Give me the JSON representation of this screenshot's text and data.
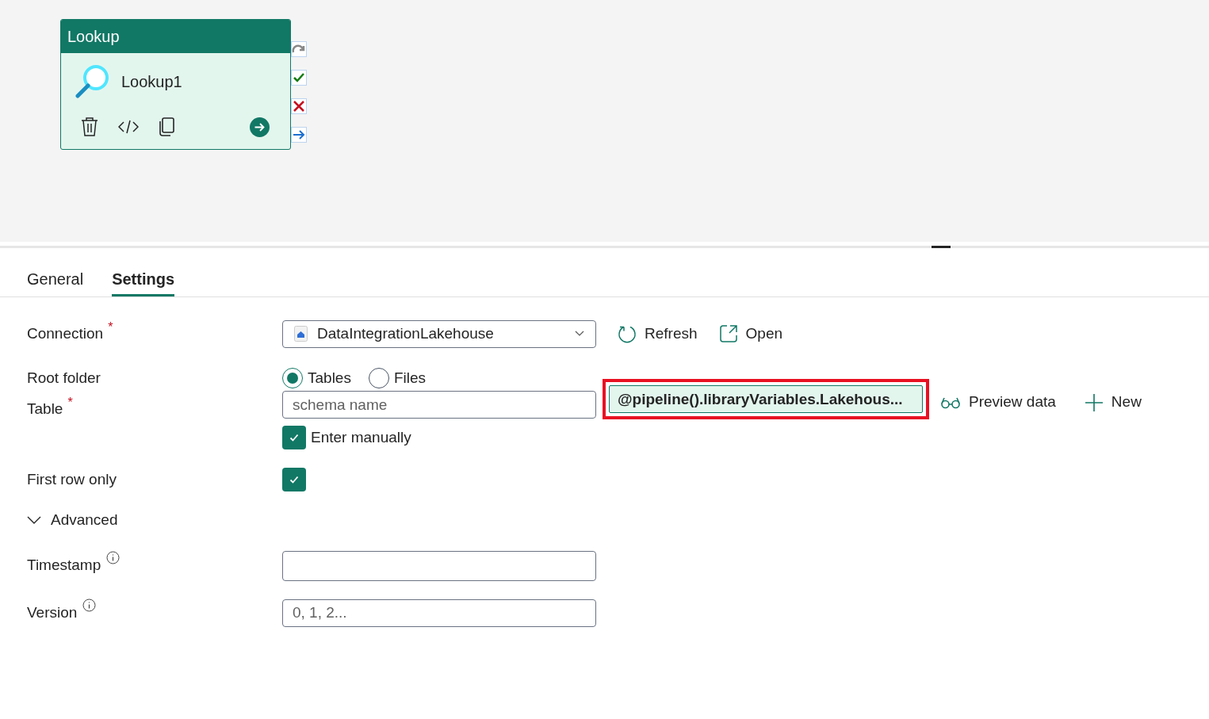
{
  "activity": {
    "type": "Lookup",
    "name": "Lookup1"
  },
  "tabs": [
    {
      "label": "General",
      "selected": false
    },
    {
      "label": "Settings",
      "selected": true
    }
  ],
  "connection": {
    "label": "Connection",
    "required_mark": "*",
    "value": "DataIntegrationLakehouse",
    "actions": [
      "Refresh",
      "Open"
    ]
  },
  "root_folder": {
    "label": "Root folder",
    "options": [
      {
        "label": "Tables",
        "selected": true
      },
      {
        "label": "Files",
        "selected": false
      }
    ]
  },
  "table": {
    "label": "Table",
    "required_mark": "*",
    "schema_placeholder": "schema name",
    "value": "@pipeline().libraryVariables.Lakehous...",
    "highlighted": true,
    "enter_manually": {
      "label": "Enter manually",
      "checked": true
    },
    "actions": [
      "Preview data",
      "New"
    ]
  },
  "first_row_only": {
    "label": "First row only",
    "checked": true
  },
  "advanced": {
    "label": "Advanced",
    "expanded": true
  },
  "timestamp": {
    "label": "Timestamp"
  },
  "version": {
    "label": "Version",
    "placeholder": "0, 1, 2..."
  }
}
